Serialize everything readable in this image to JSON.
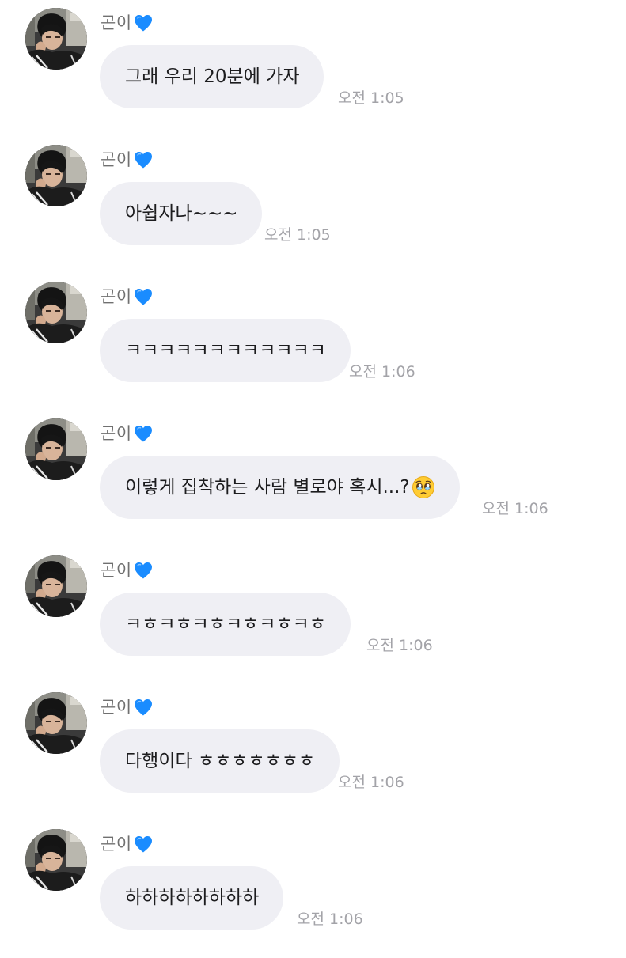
{
  "chat": {
    "sender_icon": "blue-heart-icon",
    "accent_color": "#1a8cff",
    "bubble_color": "#efeff4",
    "messages": [
      {
        "sender": "곤이",
        "text": "그래 우리 20분에 가자",
        "time": "오전 1:05"
      },
      {
        "sender": "곤이",
        "text": "아쉽자나~~~",
        "time": "오전 1:05"
      },
      {
        "sender": "곤이",
        "text": "ㅋㅋㅋㅋㅋㅋㅋㅋㅋㅋㅋㅋ",
        "time": "오전 1:06"
      },
      {
        "sender": "곤이",
        "text": "이렇게 집착하는 사람 별로야 혹시...?",
        "emoji": "pleading-face-icon",
        "time": "오전 1:06"
      },
      {
        "sender": "곤이",
        "text": "ㅋㅎㅋㅎㅋㅎㅋㅎㅋㅎㅋㅎ",
        "time": "오전 1:06"
      },
      {
        "sender": "곤이",
        "text": "다행이다 ㅎㅎㅎㅎㅎㅎㅎ",
        "time": "오전 1:06"
      },
      {
        "sender": "곤이",
        "text": "하하하하하하하하",
        "time": "오전 1:06"
      }
    ]
  }
}
